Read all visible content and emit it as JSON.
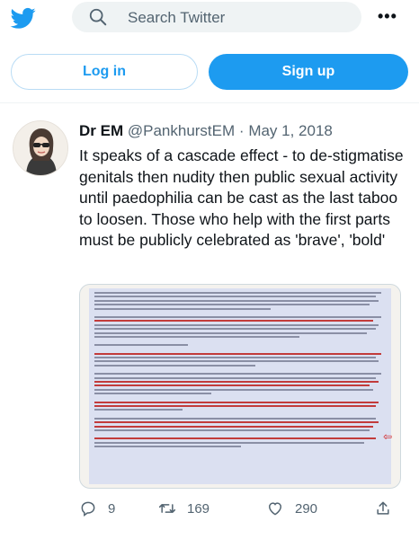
{
  "header": {
    "search_placeholder": "Search Twitter",
    "more_icon": "more-dots-icon",
    "brand_color": "#1d9bf0"
  },
  "auth": {
    "login_label": "Log in",
    "signup_label": "Sign up"
  },
  "tweet": {
    "author_name": "Dr EM",
    "handle": "@PankhurstEM",
    "separator": "·",
    "date": "May 1, 2018",
    "text": "It speaks of a cascade effect - to de-stigmatise genitals then nudity then public sexual activity until paedophilia can be cast as the last taboo to loosen. Those who help with the first parts must be publicly celebrated as 'brave', 'bold'",
    "replies": "9",
    "retweets": "169",
    "likes": "290"
  }
}
